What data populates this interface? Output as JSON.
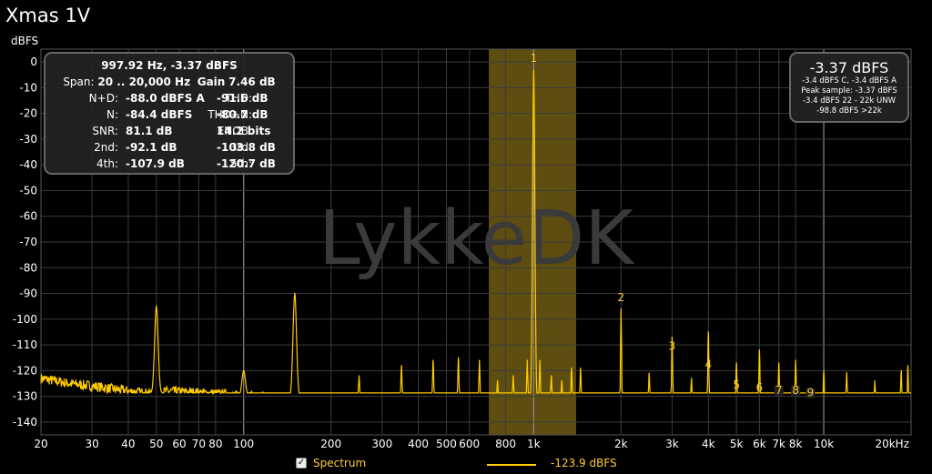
{
  "title": "Xmas 1V",
  "chart_data": {
    "type": "line",
    "ylabel": "dBFS",
    "xscale": "log",
    "xlim": [
      20,
      20000
    ],
    "ylim": [
      -145,
      5
    ],
    "x_ticks": [
      20,
      30,
      40,
      50,
      60,
      70,
      80,
      100,
      200,
      300,
      400,
      500,
      600,
      800,
      1000,
      2000,
      3000,
      4000,
      5000,
      6000,
      7000,
      8000,
      10000,
      20000
    ],
    "x_tick_labels": [
      "20",
      "30",
      "40",
      "50",
      "60",
      "70",
      "80",
      "100",
      "200",
      "300",
      "400",
      "500",
      "600",
      "800",
      "1k",
      "2k",
      "3k",
      "4k",
      "5k",
      "6k",
      "7k",
      "8k",
      "10k",
      "20kHz"
    ],
    "y_ticks": [
      0,
      -10,
      -20,
      -30,
      -40,
      -50,
      -60,
      -70,
      -80,
      -90,
      -100,
      -110,
      -120,
      -130,
      -140
    ],
    "y_tick_labels": [
      "0",
      "-10",
      "-20",
      "-30",
      "-40",
      "-50",
      "-60",
      "-70",
      "-80",
      "-90",
      "-100",
      "-110",
      "-120",
      "-130",
      "-140"
    ],
    "grid": true,
    "highlight_band": [
      700,
      1400
    ],
    "watermark": "LykkeDK",
    "series": [
      {
        "name": "Spectrum",
        "color": "#ffcc00",
        "noise_floor": [
          [
            20,
            -123
          ],
          [
            25,
            -125
          ],
          [
            30,
            -126
          ],
          [
            40,
            -128
          ],
          [
            48,
            -129
          ],
          [
            55,
            -128
          ],
          [
            80,
            -129
          ],
          [
            100,
            -130
          ],
          [
            200,
            -131
          ],
          [
            500,
            -132
          ],
          [
            700,
            -133
          ],
          [
            1000,
            -133
          ],
          [
            2000,
            -134
          ],
          [
            5000,
            -135
          ],
          [
            10000,
            -135
          ],
          [
            20000,
            -136
          ]
        ],
        "peaks": [
          [
            50,
            -95
          ],
          [
            100,
            -120
          ],
          [
            150,
            -90
          ],
          [
            250,
            -122
          ],
          [
            350,
            -118
          ],
          [
            450,
            -116
          ],
          [
            550,
            -115
          ],
          [
            650,
            -116
          ],
          [
            750,
            -124
          ],
          [
            850,
            -122
          ],
          [
            950,
            -116
          ],
          [
            1000,
            -3.37
          ],
          [
            1050,
            -116
          ],
          [
            1150,
            -122
          ],
          [
            1250,
            -124
          ],
          [
            1350,
            -119
          ],
          [
            1450,
            -119
          ],
          [
            2000,
            -96
          ],
          [
            2500,
            -121
          ],
          [
            3000,
            -107
          ],
          [
            3500,
            -123
          ],
          [
            4000,
            -105
          ],
          [
            5000,
            -117
          ],
          [
            6000,
            -112
          ],
          [
            7000,
            -117
          ],
          [
            8000,
            -116
          ],
          [
            10000,
            -120
          ],
          [
            12000,
            -121
          ],
          [
            15000,
            -124
          ],
          [
            18500,
            -120
          ],
          [
            19500,
            -118
          ]
        ]
      }
    ],
    "harmonic_markers": [
      {
        "label": "1",
        "x": 1000,
        "y": 0
      },
      {
        "label": "2",
        "x": 2000,
        "y": -93
      },
      {
        "label": "3",
        "x": 3000,
        "y": -112
      },
      {
        "label": "4",
        "x": 4000,
        "y": -119
      },
      {
        "label": "5",
        "x": 5000,
        "y": -127
      },
      {
        "label": "6",
        "x": 6000,
        "y": -128
      },
      {
        "label": "7",
        "x": 7000,
        "y": -129
      },
      {
        "label": "8",
        "x": 8000,
        "y": -129
      },
      {
        "label": "9",
        "x": 9000,
        "y": -130
      }
    ]
  },
  "stats": {
    "header": "997.92 Hz, -3.37 dBFS",
    "span_label": "Span:",
    "span_value": "20 .. 20,000 Hz",
    "gain_label": "Gain",
    "gain_value": "7.46 dB",
    "rows": [
      {
        "l1": "N+D:",
        "v1": "-88.0 dBFS A",
        "l2": "THD:",
        "v2": "-91.6 dB"
      },
      {
        "l1": "N:",
        "v1": "-84.4 dBFS",
        "l2": "THD+N:",
        "v2": "-80.7 dB"
      },
      {
        "l1": "SNR:",
        "v1": "81.1 dB",
        "l2": "ENOB:",
        "v2": "14.2 bits"
      },
      {
        "l1": "2nd:",
        "v1": "-92.1 dB",
        "l2": "3rd:",
        "v2": "-103.8 dB"
      },
      {
        "l1": "4th:",
        "v1": "-107.9 dB",
        "l2": "5th:",
        "v2": "-120.7 dB"
      }
    ]
  },
  "peak_box": {
    "big": "-3.37 dBFS",
    "lines": [
      "-3.4 dBFS C, -3.4 dBFS A",
      "Peak sample: -3.37 dBFS",
      "-3.4 dBFS 22 - 22k UNW",
      "-98.8 dBFS >22k"
    ]
  },
  "legend": {
    "checkbox_label": "Spectrum",
    "checked": true,
    "value": "-123.9 dBFS"
  }
}
